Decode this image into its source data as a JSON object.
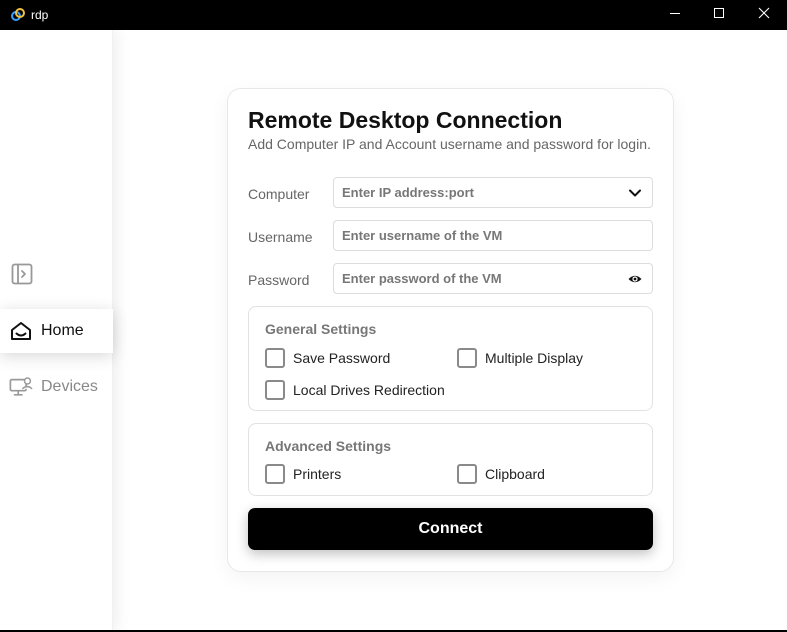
{
  "window": {
    "title": "rdp",
    "icon": "link-icon",
    "controls": [
      "minimize-icon",
      "maximize-icon",
      "close-icon"
    ]
  },
  "sidebar": {
    "toggle_icon": "sidebar-expand-icon",
    "items": [
      {
        "label": "Home",
        "icon": "home-icon",
        "active": true
      },
      {
        "label": "Devices",
        "icon": "monitor-icon",
        "active": false
      }
    ]
  },
  "form": {
    "title": "Remote Desktop Connection",
    "subtitle": "Add Computer IP and Account username and password for login.",
    "computer": {
      "label": "Computer",
      "placeholder": "Enter IP address:port",
      "value": ""
    },
    "username": {
      "label": "Username",
      "placeholder": "Enter username of the VM",
      "value": ""
    },
    "password": {
      "label": "Password",
      "placeholder": "Enter password of the VM",
      "value": ""
    },
    "general": {
      "title": "General Settings",
      "options": [
        {
          "label": "Save Password",
          "checked": false
        },
        {
          "label": "Multiple Display",
          "checked": false
        },
        {
          "label": "Local Drives Redirection",
          "checked": false
        }
      ]
    },
    "advanced": {
      "title": "Advanced Settings",
      "options": [
        {
          "label": "Printers",
          "checked": false
        },
        {
          "label": "Clipboard",
          "checked": false
        }
      ]
    },
    "connect_label": "Connect"
  },
  "colors": {
    "accent": "#000000",
    "text_muted": "#666666",
    "border": "#dcdcdc"
  }
}
